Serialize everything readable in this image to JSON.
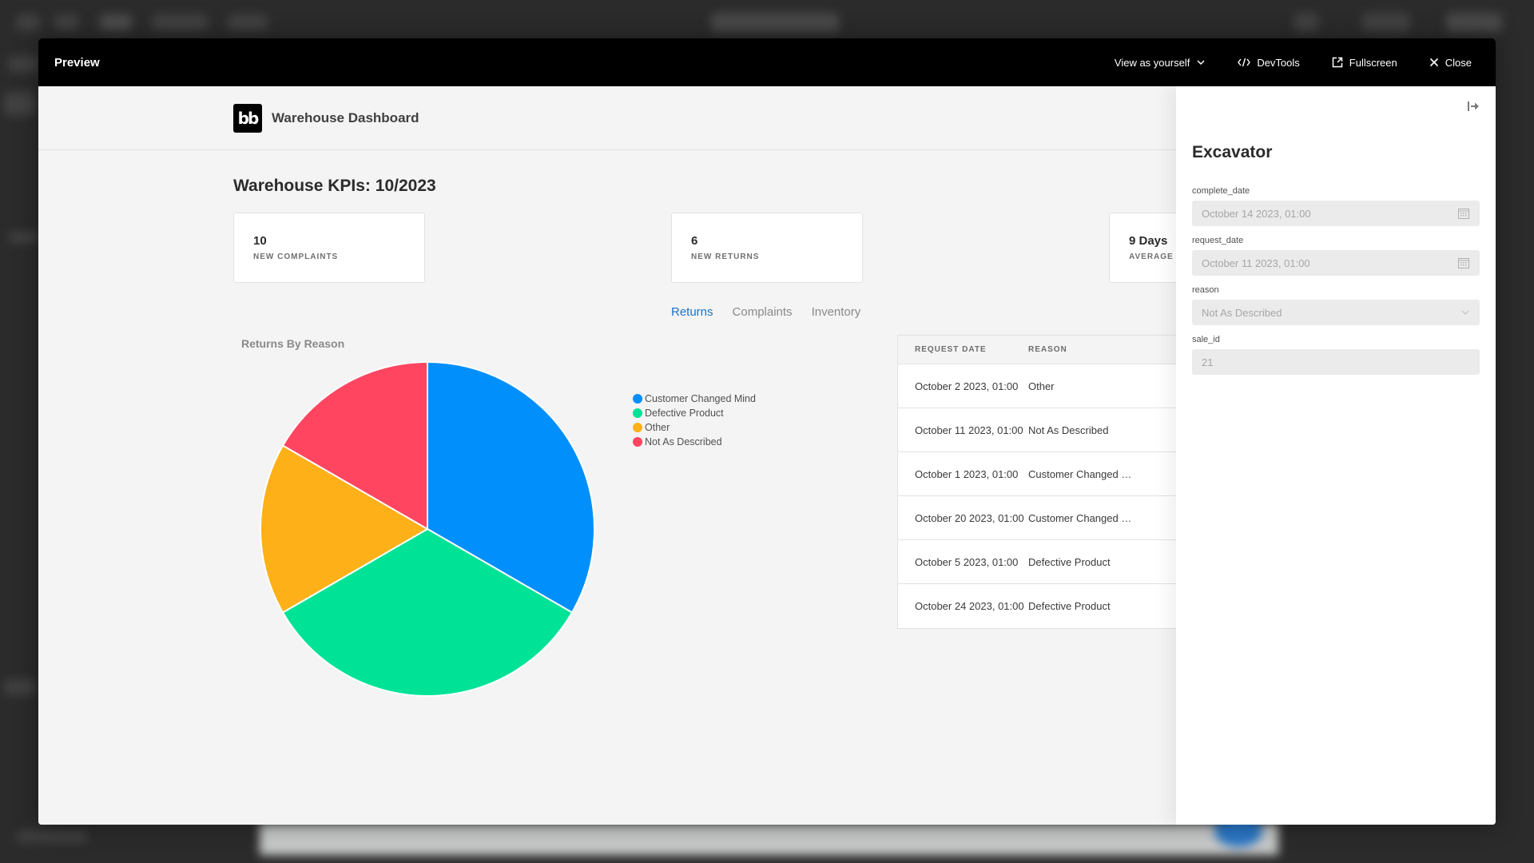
{
  "modal": {
    "title": "Preview",
    "actions": [
      {
        "label": "View as yourself",
        "icon": "chevron-down-icon"
      },
      {
        "label": "DevTools",
        "icon": "code-icon"
      },
      {
        "label": "Fullscreen",
        "icon": "external-link-icon"
      },
      {
        "label": "Close",
        "icon": "close-icon"
      }
    ]
  },
  "app": {
    "logo_text": "bb",
    "title": "Warehouse Dashboard",
    "kpi_title": "Warehouse KPIs: 10/2023",
    "kpis": [
      {
        "value": "10",
        "label": "New Complaints"
      },
      {
        "value": "6",
        "label": "New Returns"
      },
      {
        "value": "9 Days",
        "label": "Average R"
      }
    ],
    "tabs": [
      {
        "label": "Returns",
        "active": true
      },
      {
        "label": "Complaints",
        "active": false
      },
      {
        "label": "Inventory",
        "active": false
      }
    ],
    "table": {
      "headers": [
        "Request Date",
        "Reason"
      ],
      "rows": [
        [
          "October 2 2023, 01:00",
          "Other"
        ],
        [
          "October 11 2023, 01:00",
          "Not As Described"
        ],
        [
          "October 1 2023, 01:00",
          "Customer Changed Mind"
        ],
        [
          "October 20 2023, 01:00",
          "Customer Changed Mind"
        ],
        [
          "October 5 2023, 01:00",
          "Defective Product"
        ],
        [
          "October 24 2023, 01:00",
          "Defective Product"
        ]
      ]
    }
  },
  "chart_data": {
    "type": "pie",
    "title": "Returns By Reason",
    "categories": [
      "Customer Changed Mind",
      "Defective Product",
      "Other",
      "Not As Described"
    ],
    "values": [
      2,
      2,
      1,
      1
    ],
    "colors": [
      "#008FFB",
      "#00E396",
      "#FEB019",
      "#FF4560"
    ],
    "legend": "top-right"
  },
  "panel": {
    "title": "Excavator",
    "fields": [
      {
        "label": "complete_date",
        "value": "October 14 2023, 01:00",
        "icon": "calendar-icon"
      },
      {
        "label": "request_date",
        "value": "October 11 2023, 01:00",
        "icon": "calendar-icon"
      },
      {
        "label": "reason",
        "value": "Not As Described",
        "icon": "chevron-down-icon"
      },
      {
        "label": "sale_id",
        "value": "21",
        "icon": ""
      }
    ]
  }
}
